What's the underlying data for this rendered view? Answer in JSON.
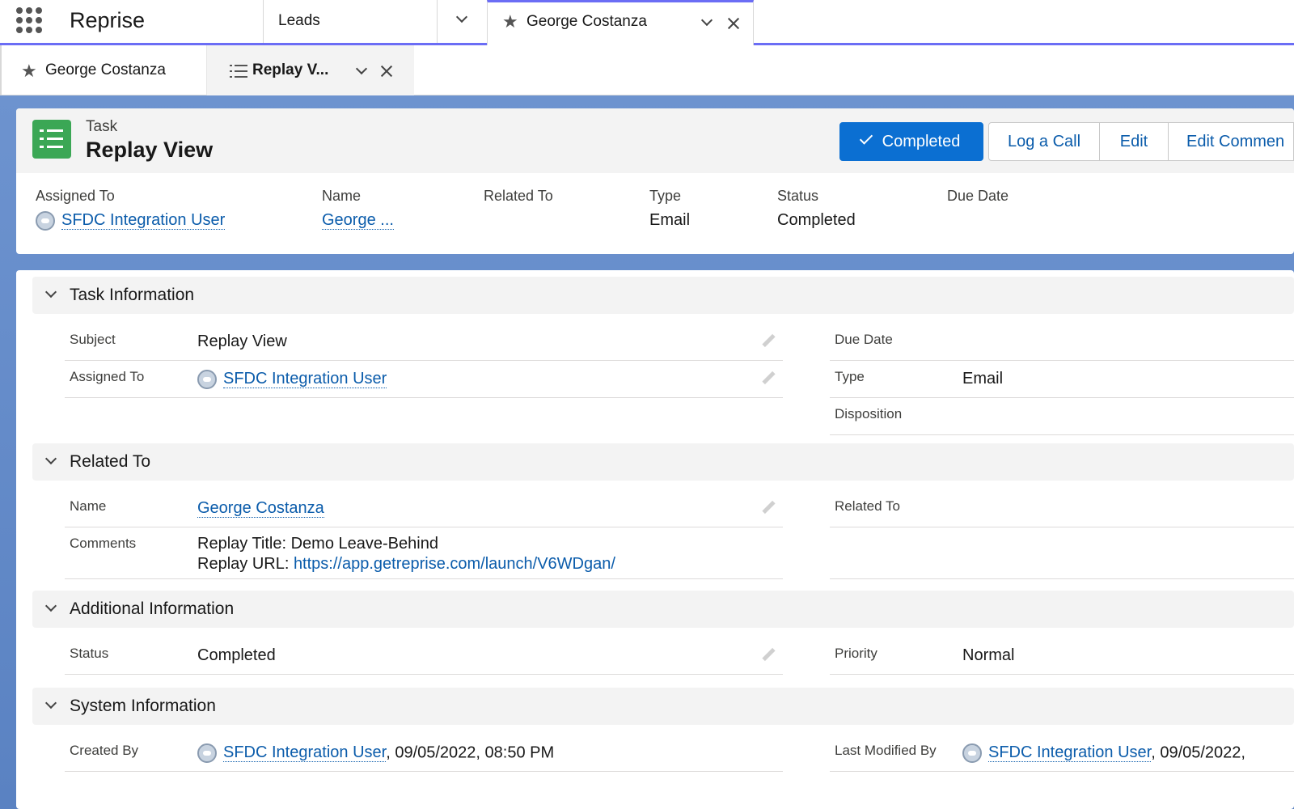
{
  "topbar": {
    "app_name": "Reprise",
    "tabs": [
      {
        "label": "Leads"
      },
      {
        "label": "George Costanza"
      }
    ]
  },
  "subtabs": [
    {
      "label": "George Costanza"
    },
    {
      "label": "Replay V..."
    }
  ],
  "header": {
    "object_type": "Task",
    "title": "Replay View",
    "buttons": {
      "completed": "Completed",
      "log_call": "Log a Call",
      "edit": "Edit",
      "edit_comments": "Edit Commen"
    },
    "fields": [
      {
        "label": "Assigned To",
        "value": "SFDC Integration User"
      },
      {
        "label": "Name",
        "value": "George ..."
      },
      {
        "label": "Related To",
        "value": ""
      },
      {
        "label": "Type",
        "value": "Email"
      },
      {
        "label": "Status",
        "value": "Completed"
      },
      {
        "label": "Due Date",
        "value": ""
      }
    ]
  },
  "sections": {
    "task_information": {
      "title": "Task Information",
      "subject_label": "Subject",
      "subject_value": "Replay View",
      "assigned_label": "Assigned To",
      "assigned_value": "SFDC Integration User",
      "due_label": "Due Date",
      "type_label": "Type",
      "type_value": "Email",
      "disposition_label": "Disposition"
    },
    "related_to": {
      "title": "Related To",
      "name_label": "Name",
      "name_value": "George Costanza",
      "related_label": "Related To",
      "comments_label": "Comments",
      "comments_line1": "Replay Title: Demo Leave-Behind",
      "comments_line2_prefix": "Replay URL: ",
      "comments_url": "https://app.getreprise.com/launch/V6WDgan/"
    },
    "additional_information": {
      "title": "Additional Information",
      "status_label": "Status",
      "status_value": "Completed",
      "priority_label": "Priority",
      "priority_value": "Normal"
    },
    "system_information": {
      "title": "System Information",
      "created_label": "Created By",
      "created_user": "SFDC Integration User",
      "created_date": ", 09/05/2022, 08:50 PM",
      "modified_label": "Last Modified By",
      "modified_user": "SFDC Integration User",
      "modified_date": ", 09/05/2022,"
    }
  },
  "icons": {
    "app_launcher": "waffle-icon",
    "record_tab": "star-icon",
    "task": "task-list-icon"
  },
  "colors": {
    "accent": "#6b6df5",
    "brand_button": "#0b6fd2",
    "task_icon": "#3ba755",
    "link": "#0b5cab"
  }
}
